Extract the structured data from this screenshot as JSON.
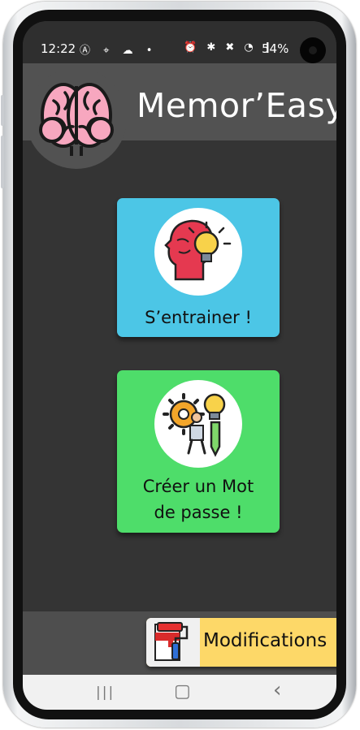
{
  "status_bar": {
    "time": "12:22",
    "left_icons": "Ⓐ ⌖ ☁ •",
    "right_icons": "⏰ ✱ ✖ ◔ ❙",
    "battery": "54%"
  },
  "header": {
    "title": "Memor’Easy",
    "logo_icon": "brain-icon"
  },
  "cards": {
    "train": {
      "label": "S’entrainer !",
      "icon": "head-lightbulb-icon",
      "color": "#4cc6e6"
    },
    "create": {
      "label_line1": "Créer un Mot",
      "label_line2": "de passe !",
      "icon": "gear-lightbulb-pencil-icon",
      "color": "#4edd6a"
    }
  },
  "bottom": {
    "modifications_label": "Modifications",
    "modifications_icon": "paint-roller-icon",
    "accent": "#fdd868"
  },
  "nav": {
    "recents": "|||",
    "home": "▢",
    "back": "‹"
  }
}
